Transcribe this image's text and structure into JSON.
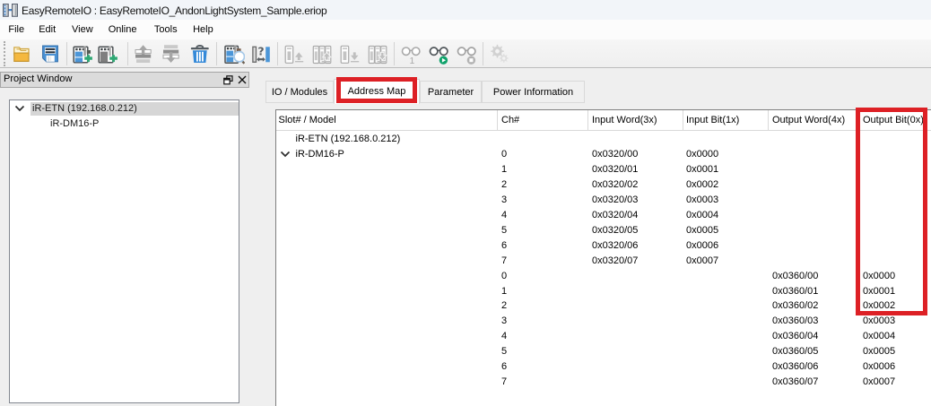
{
  "window": {
    "title": "EasyRemoteIO : EasyRemoteIO_AndonLightSystem_Sample.eriop"
  },
  "menu": {
    "items": [
      "File",
      "Edit",
      "View",
      "Online",
      "Tools",
      "Help"
    ]
  },
  "toolbar": {
    "buttons": [
      {
        "icon": "open-folder-icon",
        "enabled": true
      },
      {
        "icon": "save-icon",
        "enabled": true
      },
      {
        "icon": "add-head-module-icon",
        "enabled": true
      },
      {
        "icon": "add-expansion-module-icon",
        "enabled": true
      },
      {
        "icon": "move-module-up-icon",
        "enabled": false
      },
      {
        "icon": "move-module-down-icon",
        "enabled": false
      },
      {
        "icon": "delete-module-icon",
        "enabled": true
      },
      {
        "icon": "detect-module-icon",
        "enabled": true
      },
      {
        "icon": "module-distance-icon",
        "enabled": true
      },
      {
        "icon": "upload-module-icon",
        "enabled": false
      },
      {
        "icon": "upload-all-modules-icon",
        "enabled": false
      },
      {
        "icon": "download-module-icon",
        "enabled": false
      },
      {
        "icon": "download-all-modules-icon",
        "enabled": false
      },
      {
        "icon": "monitor-once-icon",
        "enabled": false
      },
      {
        "icon": "monitor-start-icon",
        "enabled": true
      },
      {
        "icon": "monitor-stop-icon",
        "enabled": false
      },
      {
        "icon": "settings-gears-icon",
        "enabled": false
      }
    ]
  },
  "project_window": {
    "title": "Project Window",
    "tree": [
      {
        "label": "iR-ETN (192.168.0.212)",
        "level": 0,
        "selected": true,
        "expanded": true
      },
      {
        "label": "iR-DM16-P",
        "level": 1,
        "selected": false,
        "expanded": null
      }
    ]
  },
  "tabs": [
    {
      "label": "IO / Modules",
      "selected": false
    },
    {
      "label": "Address Map",
      "selected": true
    },
    {
      "label": "Parameter",
      "selected": false
    },
    {
      "label": "Power Information",
      "selected": false
    }
  ],
  "address_map": {
    "columns": [
      "Slot# / Model",
      "Ch#",
      "Input Word(3x)",
      "Input Bit(1x)",
      "Output Word(4x)",
      "Output Bit(0x)"
    ],
    "rows": [
      {
        "slot": "iR-ETN (192.168.0.212)",
        "expanded": null,
        "ch": "",
        "iw": "",
        "ib": "",
        "ow": "",
        "ob": ""
      },
      {
        "slot": "iR-DM16-P",
        "expanded": true,
        "ch": "0",
        "iw": "0x0320/00",
        "ib": "0x0000",
        "ow": "",
        "ob": ""
      },
      {
        "slot": "",
        "expanded": null,
        "ch": "1",
        "iw": "0x0320/01",
        "ib": "0x0001",
        "ow": "",
        "ob": ""
      },
      {
        "slot": "",
        "expanded": null,
        "ch": "2",
        "iw": "0x0320/02",
        "ib": "0x0002",
        "ow": "",
        "ob": ""
      },
      {
        "slot": "",
        "expanded": null,
        "ch": "3",
        "iw": "0x0320/03",
        "ib": "0x0003",
        "ow": "",
        "ob": ""
      },
      {
        "slot": "",
        "expanded": null,
        "ch": "4",
        "iw": "0x0320/04",
        "ib": "0x0004",
        "ow": "",
        "ob": ""
      },
      {
        "slot": "",
        "expanded": null,
        "ch": "5",
        "iw": "0x0320/05",
        "ib": "0x0005",
        "ow": "",
        "ob": ""
      },
      {
        "slot": "",
        "expanded": null,
        "ch": "6",
        "iw": "0x0320/06",
        "ib": "0x0006",
        "ow": "",
        "ob": ""
      },
      {
        "slot": "",
        "expanded": null,
        "ch": "7",
        "iw": "0x0320/07",
        "ib": "0x0007",
        "ow": "",
        "ob": ""
      },
      {
        "slot": "",
        "expanded": null,
        "ch": "0",
        "iw": "",
        "ib": "",
        "ow": "0x0360/00",
        "ob": "0x0000"
      },
      {
        "slot": "",
        "expanded": null,
        "ch": "1",
        "iw": "",
        "ib": "",
        "ow": "0x0360/01",
        "ob": "0x0001"
      },
      {
        "slot": "",
        "expanded": null,
        "ch": "2",
        "iw": "",
        "ib": "",
        "ow": "0x0360/02",
        "ob": "0x0002"
      },
      {
        "slot": "",
        "expanded": null,
        "ch": "3",
        "iw": "",
        "ib": "",
        "ow": "0x0360/03",
        "ob": "0x0003"
      },
      {
        "slot": "",
        "expanded": null,
        "ch": "4",
        "iw": "",
        "ib": "",
        "ow": "0x0360/04",
        "ob": "0x0004"
      },
      {
        "slot": "",
        "expanded": null,
        "ch": "5",
        "iw": "",
        "ib": "",
        "ow": "0x0360/05",
        "ob": "0x0005"
      },
      {
        "slot": "",
        "expanded": null,
        "ch": "6",
        "iw": "",
        "ib": "",
        "ow": "0x0360/06",
        "ob": "0x0006"
      },
      {
        "slot": "",
        "expanded": null,
        "ch": "7",
        "iw": "",
        "ib": "",
        "ow": "0x0360/07",
        "ob": "0x0007"
      }
    ]
  },
  "annotations": {
    "highlight_color": "#dd2025",
    "boxes": [
      {
        "name": "address-map-tab-highlight"
      },
      {
        "name": "output-bit-column-highlight"
      }
    ]
  }
}
